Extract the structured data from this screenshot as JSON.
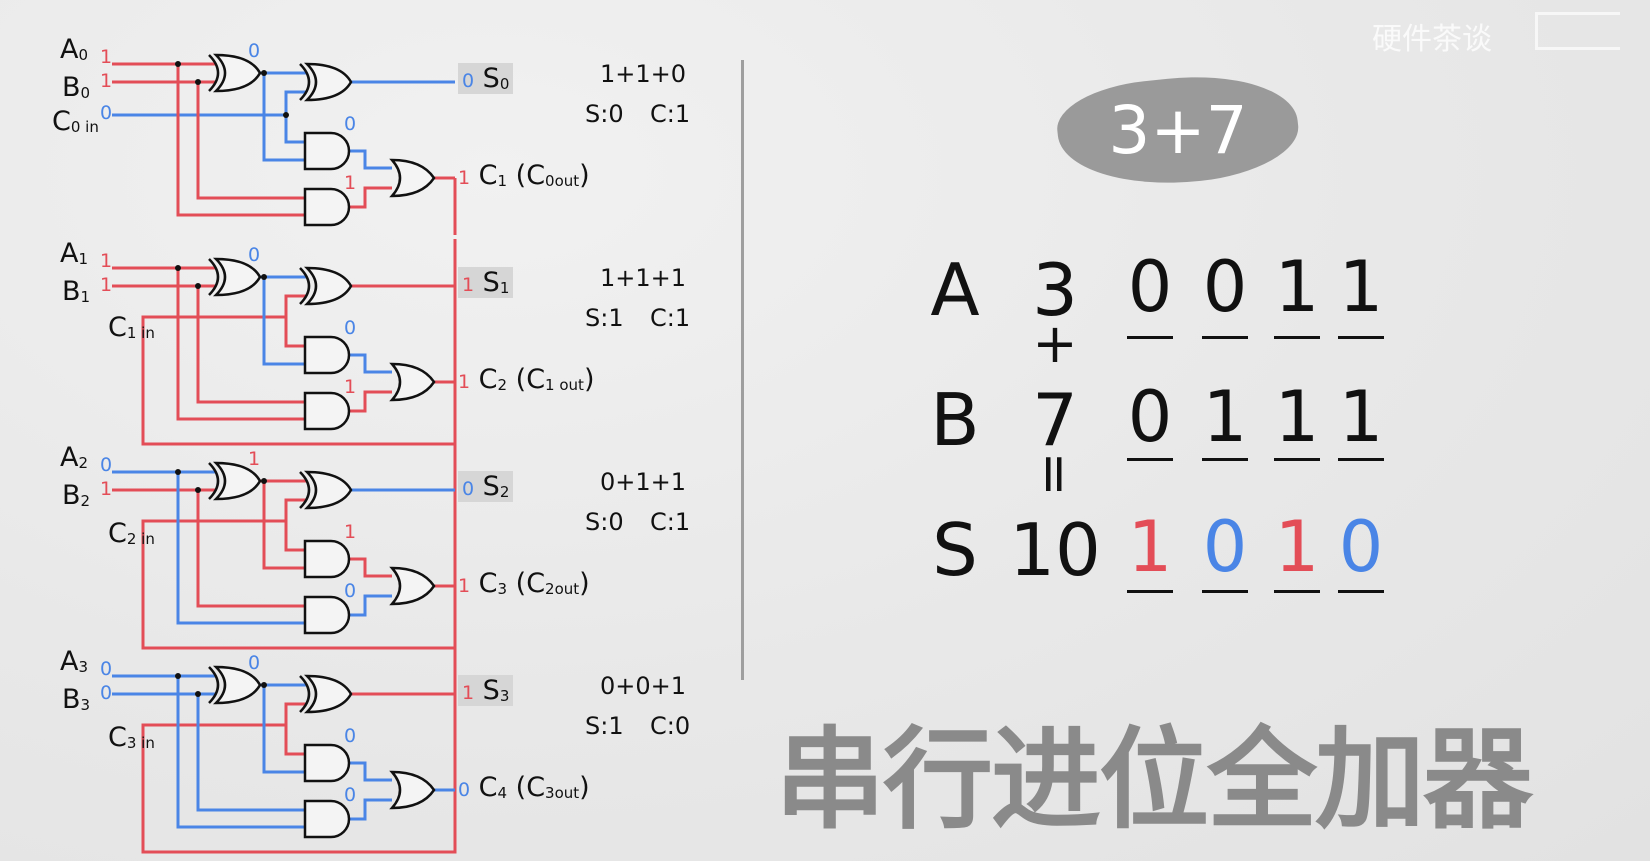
{
  "watermark": "硬件茶谈",
  "title": "3+7",
  "heading": "串行进位全加器",
  "stages": [
    {
      "a": "A",
      "a_sub": "0",
      "b": "B",
      "b_sub": "0",
      "c": "C",
      "c_sub": "0 in",
      "a_val": "1",
      "b_val": "1",
      "c_val": "0",
      "xor1_val": "0",
      "and1_val": "0",
      "and2_val": "1",
      "s_val": "0",
      "s": "S",
      "s_sub": "0",
      "co_val": "1",
      "co": "C",
      "co_sub": "1",
      "co_paren": " (C",
      "co_paren_sub": "0out",
      "co_close": ")",
      "eq": "1+1+0",
      "eq_s": "S:0",
      "eq_c": "C:1"
    },
    {
      "a": "A",
      "a_sub": "1",
      "b": "B",
      "b_sub": "1",
      "c": "C",
      "c_sub": "1 in",
      "a_val": "1",
      "b_val": "1",
      "c_val": "",
      "xor1_val": "0",
      "and1_val": "0",
      "and2_val": "1",
      "s_val": "1",
      "s": "S",
      "s_sub": "1",
      "co_val": "1",
      "co": "C",
      "co_sub": "2",
      "co_paren": " (C",
      "co_paren_sub": "1 out",
      "co_close": ")",
      "eq": "1+1+1",
      "eq_s": "S:1",
      "eq_c": "C:1"
    },
    {
      "a": "A",
      "a_sub": "2",
      "b": "B",
      "b_sub": "2",
      "c": "C",
      "c_sub": "2 in",
      "a_val": "0",
      "b_val": "1",
      "c_val": "",
      "xor1_val": "1",
      "and1_val": "1",
      "and2_val": "0",
      "s_val": "0",
      "s": "S",
      "s_sub": "2",
      "co_val": "1",
      "co": "C",
      "co_sub": "3",
      "co_paren": " (C",
      "co_paren_sub": "2out",
      "co_close": ")",
      "eq": "0+1+1",
      "eq_s": "S:0",
      "eq_c": "C:1"
    },
    {
      "a": "A",
      "a_sub": "3",
      "b": "B",
      "b_sub": "3",
      "c": "C",
      "c_sub": "3 in",
      "a_val": "0",
      "b_val": "0",
      "c_val": "",
      "xor1_val": "0",
      "and1_val": "0",
      "and2_val": "0",
      "s_val": "1",
      "s": "S",
      "s_sub": "3",
      "co_val": "0",
      "co": "C",
      "co_sub": "4",
      "co_paren": " (C",
      "co_paren_sub": "3out",
      "co_close": ")",
      "eq": "0+0+1",
      "eq_s": "S:1",
      "eq_c": "C:0"
    }
  ],
  "table": {
    "a_label": "A",
    "a_dec": "3",
    "a_bits": [
      "0",
      "0",
      "1",
      "1"
    ],
    "plus": "+",
    "b_label": "B",
    "b_dec": "7",
    "b_bits": [
      "0",
      "1",
      "1",
      "1"
    ],
    "equals": "=",
    "s_label": "S",
    "s_dec": "10",
    "s_bits": [
      "1",
      "0",
      "1",
      "0"
    ]
  },
  "colors": {
    "one": "#e34d57",
    "zero": "#4a85e6",
    "ink": "#111111",
    "heading": "#8a8a8a"
  }
}
